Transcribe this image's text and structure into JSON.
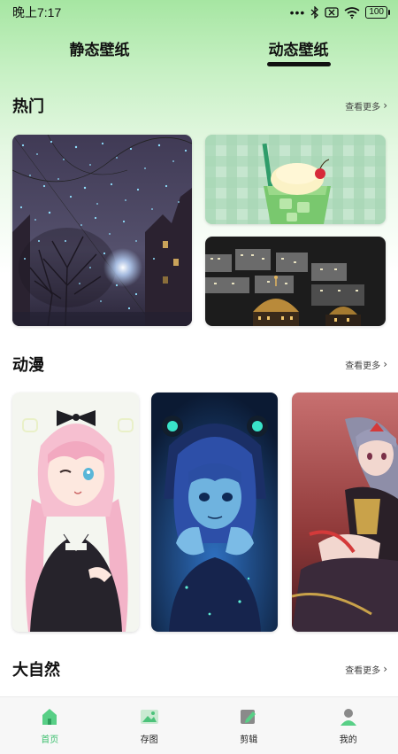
{
  "status_bar": {
    "time": "晚上7:17",
    "battery": "100"
  },
  "tabs": [
    {
      "label": "静态壁纸",
      "active": false
    },
    {
      "label": "动态壁纸",
      "active": true
    }
  ],
  "sections": [
    {
      "title": "热门",
      "more": "查看更多"
    },
    {
      "title": "动漫",
      "more": "查看更多"
    },
    {
      "title": "大自然",
      "more": "查看更多"
    }
  ],
  "bottom_nav": [
    {
      "label": "首页",
      "icon": "home-icon",
      "active": true
    },
    {
      "label": "存图",
      "icon": "image-icon",
      "active": false
    },
    {
      "label": "剪辑",
      "icon": "edit-icon",
      "active": false
    },
    {
      "label": "我的",
      "icon": "user-icon",
      "active": false
    }
  ],
  "colors": {
    "accent": "#3cbf6e",
    "gradient_top": "#a6e6a2"
  }
}
